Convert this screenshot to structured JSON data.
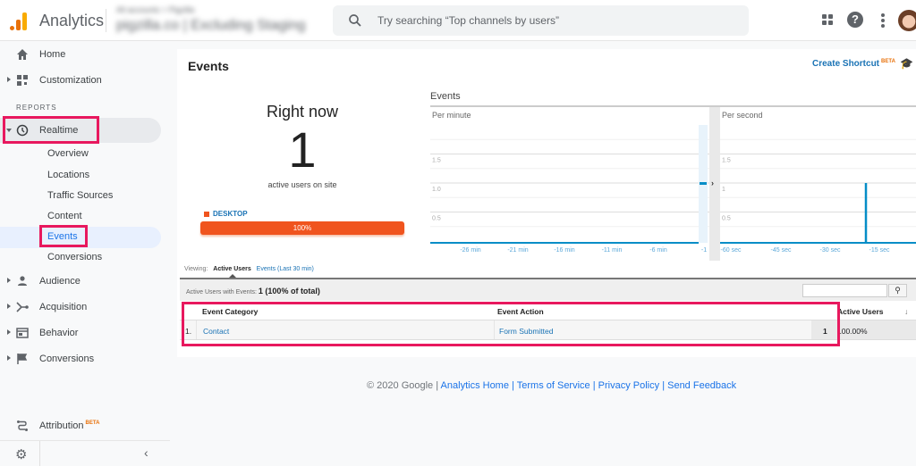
{
  "topbar": {
    "app_title": "Analytics",
    "account_breadcrumb": "All accounts > Pigzilla",
    "property_view": "pigzilla.co | Excluding Staging",
    "search_placeholder": "Try searching “Top channels by users”",
    "icons": [
      "apps-icon",
      "help-icon",
      "more-vert-icon",
      "avatar"
    ]
  },
  "sidebar": {
    "home": "Home",
    "customization": "Customization",
    "reports_label": "REPORTS",
    "realtime": "Realtime",
    "realtime_sub": [
      "Overview",
      "Locations",
      "Traffic Sources",
      "Content",
      "Events",
      "Conversions"
    ],
    "active_sub": "Events",
    "sections": [
      "Audience",
      "Acquisition",
      "Behavior",
      "Conversions"
    ],
    "attribution": "Attribution",
    "attribution_badge": "BETA"
  },
  "main": {
    "title": "Events",
    "create_shortcut": "Create Shortcut",
    "shortcut_badge": "BETA",
    "right_now_label": "Right now",
    "active_users": "1",
    "active_users_sub": "active users on site",
    "device": {
      "label": "DESKTOP",
      "percent_text": "100%",
      "share": 1.0,
      "color": "#f0541e"
    },
    "charts_title": "Events",
    "viewing_label": "Viewing:",
    "viewing_active": "Active Users",
    "viewing_other": "Events (Last 30 min)",
    "summary_prefix": "Active Users with Events:",
    "summary_value": "1 (100% of total)",
    "table": {
      "columns": [
        "Event Category",
        "Event Action",
        "Active Users"
      ],
      "sort_icon": "arrow-down-icon",
      "rows": [
        {
          "num": "1.",
          "category": "Contact",
          "action": "Form Submitted",
          "value": "1",
          "percent": "100.00%"
        }
      ]
    }
  },
  "chart_data": [
    {
      "type": "bar",
      "title": "Per minute",
      "categories": [
        "-26 min",
        "-21 min",
        "-16 min",
        "-11 min",
        "-6 min",
        "-1"
      ],
      "x_range": [
        -30,
        -1
      ],
      "values_by_minute": [
        {
          "x": -1,
          "y": 1
        }
      ],
      "yticks": [
        "0.5",
        "1.0",
        "1.5"
      ],
      "ylim": [
        0,
        2
      ],
      "grid": true,
      "color": "#058dc7"
    },
    {
      "type": "bar",
      "title": "Per second",
      "categories": [
        "-60 sec",
        "-45 sec",
        "-30 sec",
        "-15 sec"
      ],
      "x_range": [
        -60,
        0
      ],
      "values_by_second": [
        {
          "x": -14,
          "y": 1
        }
      ],
      "yticks": [
        "0.5",
        "1",
        "1.5"
      ],
      "ylim": [
        0,
        2
      ],
      "grid": true,
      "color": "#058dc7"
    }
  ],
  "footer": {
    "copyright": "© 2020 Google",
    "links": [
      "Analytics Home",
      "Terms of Service",
      "Privacy Policy",
      "Send Feedback"
    ]
  }
}
